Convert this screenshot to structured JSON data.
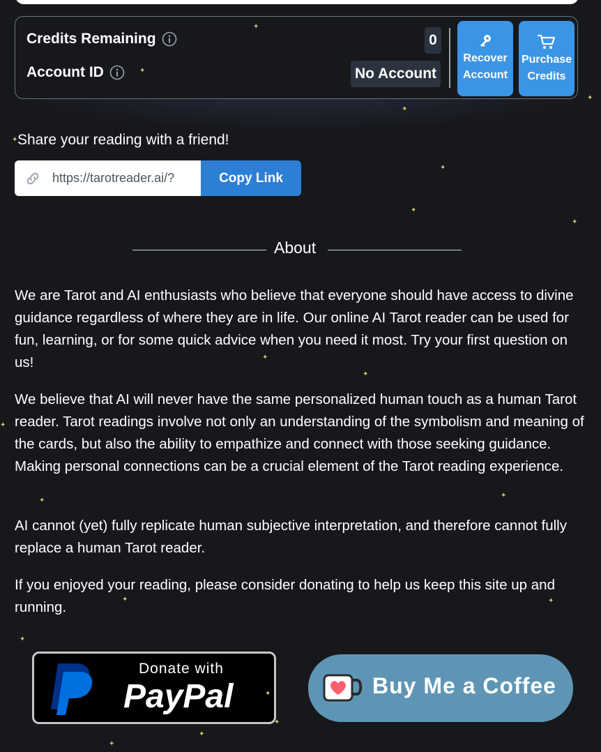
{
  "credits": {
    "credits_label": "Credits Remaining",
    "credits_value": "0",
    "account_label": "Account ID",
    "account_value": "No Account",
    "recover_label_1": "Recover",
    "recover_label_2": "Account",
    "purchase_label_1": "Purchase",
    "purchase_label_2": "Credits"
  },
  "share": {
    "title": "Share your reading with a friend!",
    "link_value": "https://tarotreader.ai/?",
    "copy_label": "Copy Link"
  },
  "about": {
    "heading": "About",
    "paragraphs": [
      "We are Tarot and AI enthusiasts who believe that everyone should have access to divine guidance regardless of where they are in life. Our online AI Tarot reader can be used for fun, learning, or for some quick advice when you need it most. Try your first question on us!",
      "We believe that AI will never have the same personalized human touch as a human Tarot reader. Tarot readings involve not only an understanding of the symbolism and meaning of the cards, but also the ability to empathize and connect with those seeking guidance. Making personal connections can be a crucial element of the Tarot reading experience.",
      "AI cannot (yet) fully replicate human subjective interpretation, and therefore cannot fully replace a human Tarot reader.",
      "If you enjoyed your reading, please consider donating to help us keep this site up and running."
    ]
  },
  "donate": {
    "paypal_small": "Donate with",
    "paypal_big": "PayPal",
    "bmc_label": "Buy Me a Coffee"
  },
  "colors": {
    "background": "#17181c",
    "accent_blue": "#3b95e6",
    "copy_blue": "#2d7fd6",
    "bmc_blue": "#5f95b4",
    "paypal_dark": "#003087",
    "paypal_light": "#0070e0"
  },
  "icons": {
    "info": "info-icon",
    "key": "key-icon",
    "cart": "cart-icon",
    "link": "link-icon",
    "paypal": "paypal-logo-icon",
    "kofi_cup": "coffee-cup-heart-icon"
  }
}
